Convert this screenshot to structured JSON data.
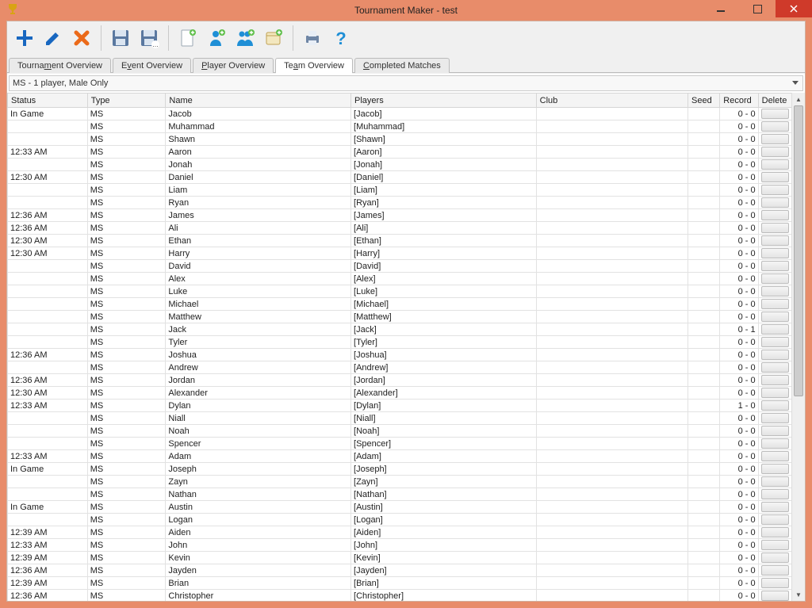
{
  "window": {
    "title": "Tournament Maker - test"
  },
  "tabs": [
    {
      "label": "Tournament Overview",
      "name": "tab-tournament-overview"
    },
    {
      "label": "Event Overview",
      "name": "tab-event-overview"
    },
    {
      "label": "Player Overview",
      "name": "tab-player-overview"
    },
    {
      "label": "Team Overview",
      "name": "tab-team-overview"
    },
    {
      "label": "Completed Matches",
      "name": "tab-completed-matches"
    }
  ],
  "active_tab_index": 3,
  "combo": {
    "selected": "MS - 1 player, Male Only"
  },
  "columns": {
    "status": "Status",
    "type": "Type",
    "name": "Name",
    "players": "Players",
    "club": "Club",
    "seed": "Seed",
    "record": "Record",
    "delete": "Delete"
  },
  "rows": [
    {
      "status": "In Game",
      "status_class": "red",
      "type": "MS",
      "name": "Jacob",
      "players": "[Jacob]",
      "club": "",
      "seed": "",
      "record": "0 - 0"
    },
    {
      "status": "",
      "status_class": "",
      "type": "MS",
      "name": "Muhammad",
      "players": "[Muhammad]",
      "club": "",
      "seed": "",
      "record": "0 - 0"
    },
    {
      "status": "",
      "status_class": "",
      "type": "MS",
      "name": "Shawn",
      "players": "[Shawn]",
      "club": "",
      "seed": "",
      "record": "0 - 0"
    },
    {
      "status": "12:33 AM",
      "status_class": "green",
      "type": "MS",
      "name": "Aaron",
      "players": "[Aaron]",
      "club": "",
      "seed": "",
      "record": "0 - 0"
    },
    {
      "status": "",
      "status_class": "",
      "type": "MS",
      "name": "Jonah",
      "players": "[Jonah]",
      "club": "",
      "seed": "",
      "record": "0 - 0"
    },
    {
      "status": "12:30 AM",
      "status_class": "green",
      "type": "MS",
      "name": "Daniel",
      "players": "[Daniel]",
      "club": "",
      "seed": "",
      "record": "0 - 0"
    },
    {
      "status": "",
      "status_class": "",
      "type": "MS",
      "name": "Liam",
      "players": "[Liam]",
      "club": "",
      "seed": "",
      "record": "0 - 0"
    },
    {
      "status": "",
      "status_class": "",
      "type": "MS",
      "name": "Ryan",
      "players": "[Ryan]",
      "club": "",
      "seed": "",
      "record": "0 - 0"
    },
    {
      "status": "12:36 AM",
      "status_class": "green",
      "type": "MS",
      "name": "James",
      "players": "[James]",
      "club": "",
      "seed": "",
      "record": "0 - 0"
    },
    {
      "status": "12:36 AM",
      "status_class": "green",
      "type": "MS",
      "name": "Ali",
      "players": "[Ali]",
      "club": "",
      "seed": "",
      "record": "0 - 0"
    },
    {
      "status": "12:30 AM",
      "status_class": "green",
      "type": "MS",
      "name": "Ethan",
      "players": "[Ethan]",
      "club": "",
      "seed": "",
      "record": "0 - 0"
    },
    {
      "status": "12:30 AM",
      "status_class": "green",
      "type": "MS",
      "name": "Harry",
      "players": "[Harry]",
      "club": "",
      "seed": "",
      "record": "0 - 0"
    },
    {
      "status": "",
      "status_class": "",
      "type": "MS",
      "name": "David",
      "players": "[David]",
      "club": "",
      "seed": "",
      "record": "0 - 0"
    },
    {
      "status": "",
      "status_class": "",
      "type": "MS",
      "name": "Alex",
      "players": "[Alex]",
      "club": "",
      "seed": "",
      "record": "0 - 0"
    },
    {
      "status": "",
      "status_class": "",
      "type": "MS",
      "name": "Luke",
      "players": "[Luke]",
      "club": "",
      "seed": "",
      "record": "0 - 0"
    },
    {
      "status": "",
      "status_class": "",
      "type": "MS",
      "name": "Michael",
      "players": "[Michael]",
      "club": "",
      "seed": "",
      "record": "0 - 0"
    },
    {
      "status": "",
      "status_class": "",
      "type": "MS",
      "name": "Matthew",
      "players": "[Matthew]",
      "club": "",
      "seed": "",
      "record": "0 - 0"
    },
    {
      "status": "",
      "status_class": "",
      "type": "MS",
      "name": "Jack",
      "players": "[Jack]",
      "club": "",
      "seed": "",
      "record": "0 - 1"
    },
    {
      "status": "",
      "status_class": "",
      "type": "MS",
      "name": "Tyler",
      "players": "[Tyler]",
      "club": "",
      "seed": "",
      "record": "0 - 0"
    },
    {
      "status": "12:36 AM",
      "status_class": "green",
      "type": "MS",
      "name": "Joshua",
      "players": "[Joshua]",
      "club": "",
      "seed": "",
      "record": "0 - 0"
    },
    {
      "status": "",
      "status_class": "",
      "type": "MS",
      "name": "Andrew",
      "players": "[Andrew]",
      "club": "",
      "seed": "",
      "record": "0 - 0"
    },
    {
      "status": "12:36 AM",
      "status_class": "green",
      "type": "MS",
      "name": "Jordan",
      "players": "[Jordan]",
      "club": "",
      "seed": "",
      "record": "0 - 0"
    },
    {
      "status": "12:30 AM",
      "status_class": "green",
      "type": "MS",
      "name": "Alexander",
      "players": "[Alexander]",
      "club": "",
      "seed": "",
      "record": "0 - 0"
    },
    {
      "status": "12:33 AM",
      "status_class": "green",
      "type": "MS",
      "name": "Dylan",
      "players": "[Dylan]",
      "club": "",
      "seed": "",
      "record": "1 - 0"
    },
    {
      "status": "",
      "status_class": "",
      "type": "MS",
      "name": "Niall",
      "players": "[Niall]",
      "club": "",
      "seed": "",
      "record": "0 - 0"
    },
    {
      "status": "",
      "status_class": "",
      "type": "MS",
      "name": "Noah",
      "players": "[Noah]",
      "club": "",
      "seed": "",
      "record": "0 - 0"
    },
    {
      "status": "",
      "status_class": "",
      "type": "MS",
      "name": "Spencer",
      "players": "[Spencer]",
      "club": "",
      "seed": "",
      "record": "0 - 0"
    },
    {
      "status": "12:33 AM",
      "status_class": "green",
      "type": "MS",
      "name": "Adam",
      "players": "[Adam]",
      "club": "",
      "seed": "",
      "record": "0 - 0"
    },
    {
      "status": "In Game",
      "status_class": "red",
      "type": "MS",
      "name": "Joseph",
      "players": "[Joseph]",
      "club": "",
      "seed": "",
      "record": "0 - 0"
    },
    {
      "status": "",
      "status_class": "",
      "type": "MS",
      "name": "Zayn",
      "players": "[Zayn]",
      "club": "",
      "seed": "",
      "record": "0 - 0"
    },
    {
      "status": "",
      "status_class": "",
      "type": "MS",
      "name": "Nathan",
      "players": "[Nathan]",
      "club": "",
      "seed": "",
      "record": "0 - 0"
    },
    {
      "status": "In Game",
      "status_class": "red",
      "type": "MS",
      "name": "Austin",
      "players": "[Austin]",
      "club": "",
      "seed": "",
      "record": "0 - 0"
    },
    {
      "status": "",
      "status_class": "",
      "type": "MS",
      "name": "Logan",
      "players": "[Logan]",
      "club": "",
      "seed": "",
      "record": "0 - 0"
    },
    {
      "status": "12:39 AM",
      "status_class": "green",
      "type": "MS",
      "name": "Aiden",
      "players": "[Aiden]",
      "club": "",
      "seed": "",
      "record": "0 - 0"
    },
    {
      "status": "12:33 AM",
      "status_class": "green",
      "type": "MS",
      "name": "John",
      "players": "[John]",
      "club": "",
      "seed": "",
      "record": "0 - 0"
    },
    {
      "status": "12:39 AM",
      "status_class": "green",
      "type": "MS",
      "name": "Kevin",
      "players": "[Kevin]",
      "club": "",
      "seed": "",
      "record": "0 - 0"
    },
    {
      "status": "12:36 AM",
      "status_class": "green",
      "type": "MS",
      "name": "Jayden",
      "players": "[Jayden]",
      "club": "",
      "seed": "",
      "record": "0 - 0"
    },
    {
      "status": "12:39 AM",
      "status_class": "green",
      "type": "MS",
      "name": "Brian",
      "players": "[Brian]",
      "club": "",
      "seed": "",
      "record": "0 - 0"
    },
    {
      "status": "12:36 AM",
      "status_class": "green",
      "type": "MS",
      "name": "Christopher",
      "players": "[Christopher]",
      "club": "",
      "seed": "",
      "record": "0 - 0"
    }
  ]
}
